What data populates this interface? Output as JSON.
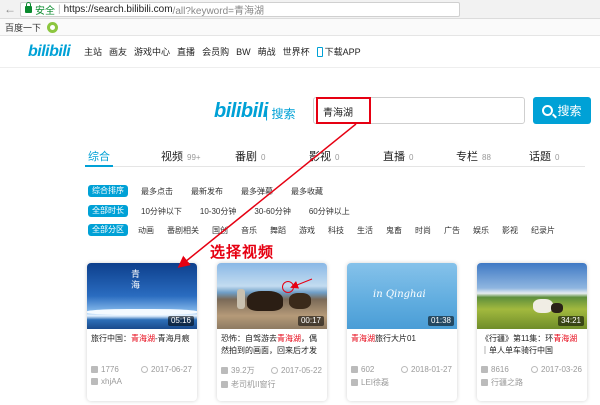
{
  "browser": {
    "back_arrow": "←",
    "secure_label": "安全",
    "separator": "|",
    "url_main": "https://search.bilibili.com",
    "url_rest": "/all?keyword=青海湖",
    "bookmark_label": "百度一下"
  },
  "site_nav": {
    "logo": "bilibili",
    "items": [
      "主站",
      "画友",
      "游戏中心",
      "直播",
      "会员购",
      "BW",
      "萌战",
      "世界杯"
    ],
    "download_label": "下载APP"
  },
  "search": {
    "logo": "bilibili",
    "logo_sub": "| 搜索",
    "query": "青海湖",
    "button_label": "搜索"
  },
  "tabs": [
    {
      "label": "综合",
      "count": "",
      "active": true
    },
    {
      "label": "视频",
      "count": "99+"
    },
    {
      "label": "番剧",
      "count": "0"
    },
    {
      "label": "影视",
      "count": "0"
    },
    {
      "label": "直播",
      "count": "0"
    },
    {
      "label": "专栏",
      "count": "88"
    },
    {
      "label": "话题",
      "count": "0"
    }
  ],
  "filters": {
    "sort": {
      "chip": "综合排序",
      "options": [
        "最多点击",
        "最新发布",
        "最多弹幕",
        "最多收藏"
      ]
    },
    "duration": {
      "chip": "全部时长",
      "options": [
        "10分钟以下",
        "10-30分钟",
        "30-60分钟",
        "60分钟以上"
      ]
    },
    "zone": {
      "chip": "全部分区",
      "options": [
        "动画",
        "番剧相关",
        "国创",
        "音乐",
        "舞蹈",
        "游戏",
        "科技",
        "生活",
        "鬼畜",
        "时尚",
        "广告",
        "娱乐",
        "影视",
        "纪录片"
      ]
    }
  },
  "annotation": {
    "text": "选择视频",
    "color": "#e60012"
  },
  "videos": [
    {
      "duration": "05:16",
      "title_pre": "旅行中国：",
      "title_hl": "青海湖",
      "title_post": "-青海月痕",
      "plays": "1776",
      "date": "2017-06-27",
      "uploader": "xhjAA",
      "thumb_text": "青海"
    },
    {
      "duration": "00:17",
      "title_pre": "恐怖：自驾游去",
      "title_hl": "青海湖",
      "title_post": "，偶然拍到的画面，回来后才发",
      "plays": "39.2万",
      "date": "2017-05-22",
      "uploader": "老司机II窗行"
    },
    {
      "duration": "01:38",
      "title_pre": "",
      "title_hl": "青海湖",
      "title_post": "旅行大片01",
      "plays": "602",
      "date": "2018-01-27",
      "uploader": "LEI徐磊",
      "thumb_text": "in Qinghai"
    },
    {
      "duration": "34:21",
      "title_pre": "《行疆》第11集：环",
      "title_hl": "青海湖",
      "title_post": "｜单人单车骑行中国",
      "plays": "8616",
      "date": "2017-03-26",
      "uploader": "行疆之路"
    }
  ],
  "colors": {
    "accent": "#00a1d6",
    "highlight": "#e60012"
  }
}
